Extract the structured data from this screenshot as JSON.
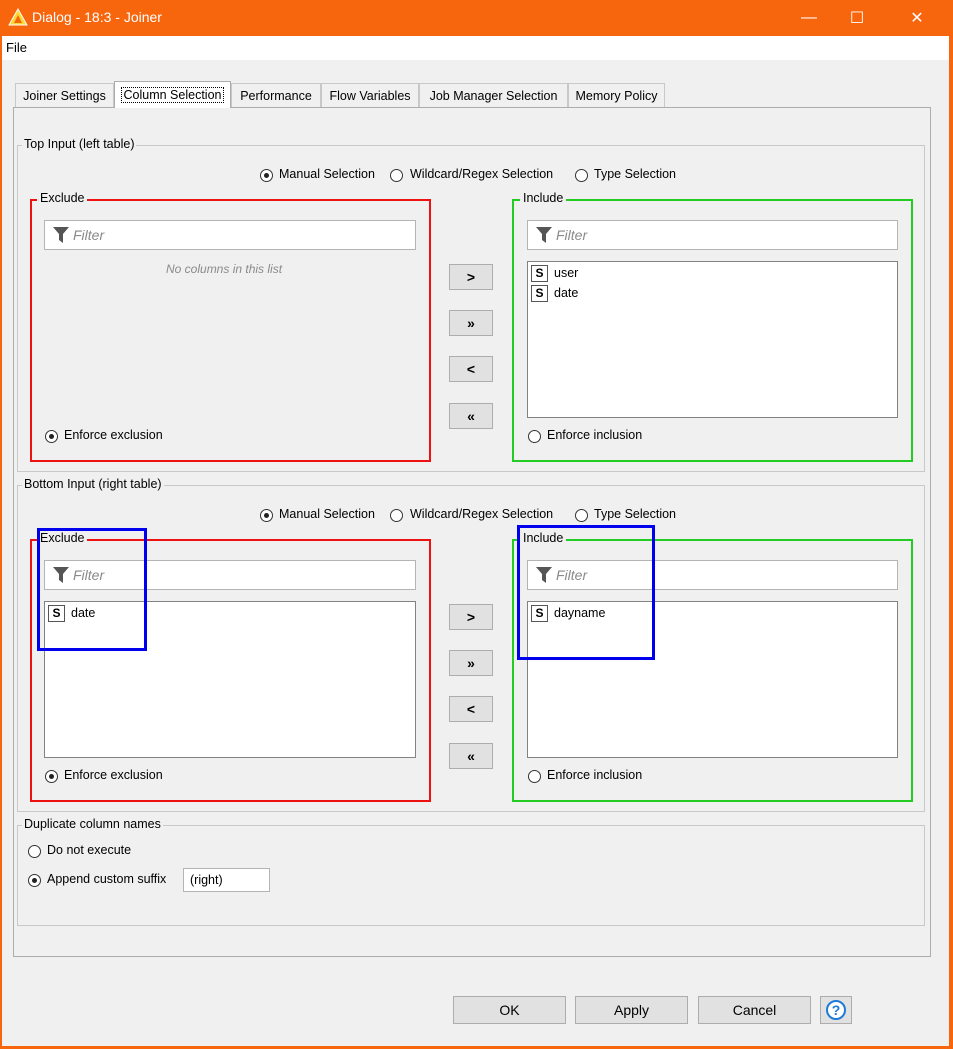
{
  "window": {
    "title": "Dialog - 18:3 - Joiner",
    "minimize_icon": "—",
    "maximize_icon": "☐",
    "close_icon": "✕"
  },
  "menu": {
    "file": "File"
  },
  "tabs": [
    {
      "label": "Joiner Settings"
    },
    {
      "label": "Column Selection"
    },
    {
      "label": "Performance"
    },
    {
      "label": "Flow Variables"
    },
    {
      "label": "Job Manager Selection"
    },
    {
      "label": "Memory Policy"
    }
  ],
  "top_input": {
    "title": "Top Input (left table)",
    "modes": [
      "Manual Selection",
      "Wildcard/Regex Selection",
      "Type Selection"
    ],
    "selected_mode": "Manual Selection",
    "exclude": {
      "title": "Exclude",
      "filter_placeholder": "Filter",
      "empty_message": "No columns in this list",
      "items": [],
      "enforce_label": "Enforce exclusion",
      "enforce_checked": true
    },
    "include": {
      "title": "Include",
      "filter_placeholder": "Filter",
      "items": [
        {
          "type": "S",
          "name": "user"
        },
        {
          "type": "S",
          "name": "date"
        }
      ],
      "enforce_label": "Enforce inclusion",
      "enforce_checked": false
    }
  },
  "bottom_input": {
    "title": "Bottom Input (right table)",
    "modes": [
      "Manual Selection",
      "Wildcard/Regex Selection",
      "Type Selection"
    ],
    "selected_mode": "Manual Selection",
    "exclude": {
      "title": "Exclude",
      "filter_placeholder": "Filter",
      "items": [
        {
          "type": "S",
          "name": "date"
        }
      ],
      "enforce_label": "Enforce exclusion",
      "enforce_checked": true
    },
    "include": {
      "title": "Include",
      "filter_placeholder": "Filter",
      "items": [
        {
          "type": "S",
          "name": "dayname"
        }
      ],
      "enforce_label": "Enforce inclusion",
      "enforce_checked": false
    }
  },
  "move_buttons": {
    "add": ">",
    "add_all": "»",
    "remove": "<",
    "remove_all": "«"
  },
  "duplicates": {
    "title": "Duplicate column names",
    "option_do_not_execute": "Do not execute",
    "option_append_suffix": "Append custom suffix",
    "selected": "Append custom suffix",
    "suffix_value": "(right)"
  },
  "buttons": {
    "ok": "OK",
    "apply": "Apply",
    "cancel": "Cancel",
    "help": "?"
  },
  "colors": {
    "titlebar": "#f7650d",
    "exclude_border": "#ee1111",
    "include_border": "#22cc22",
    "highlight_border": "#0000ee"
  }
}
